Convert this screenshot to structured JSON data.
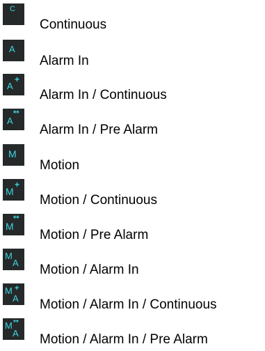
{
  "legend": {
    "colors": {
      "icon_background": "#25292a",
      "icon_glyph": "#3fd6e2",
      "label_text": "#000000"
    },
    "items": [
      {
        "icon": "continuous-icon",
        "glyph": "C",
        "sup": "",
        "sub": "",
        "label": "Continuous"
      },
      {
        "icon": "alarm-in-icon",
        "glyph": "A",
        "sup": "",
        "sub": "",
        "label": "Alarm In"
      },
      {
        "icon": "alarm-in-continuous-icon",
        "glyph": "A",
        "sup": "+",
        "sub": "",
        "label": "Alarm In / Continuous"
      },
      {
        "icon": "alarm-in-pre-alarm-icon",
        "glyph": "A",
        "sup": "**",
        "sub": "",
        "label": "Alarm In / Pre Alarm"
      },
      {
        "icon": "motion-icon",
        "glyph": "M",
        "sup": "",
        "sub": "",
        "label": "Motion"
      },
      {
        "icon": "motion-continuous-icon",
        "glyph": "M",
        "sup": "+",
        "sub": "",
        "label": "Motion / Continuous"
      },
      {
        "icon": "motion-pre-alarm-icon",
        "glyph": "M",
        "sup": "**",
        "sub": "",
        "label": "Motion / Pre Alarm"
      },
      {
        "icon": "motion-alarm-in-icon",
        "glyph": "M",
        "sup": "",
        "sub": "A",
        "label": "Motion / Alarm In"
      },
      {
        "icon": "motion-alarm-in-continuous-icon",
        "glyph": "M",
        "sup": "+",
        "sub": "A",
        "label": "Motion / Alarm In / Continuous"
      },
      {
        "icon": "motion-alarm-in-pre-alarm-icon",
        "glyph": "M",
        "sup": "**",
        "sub": "A",
        "label": "Motion / Alarm In / Pre Alarm"
      }
    ]
  }
}
